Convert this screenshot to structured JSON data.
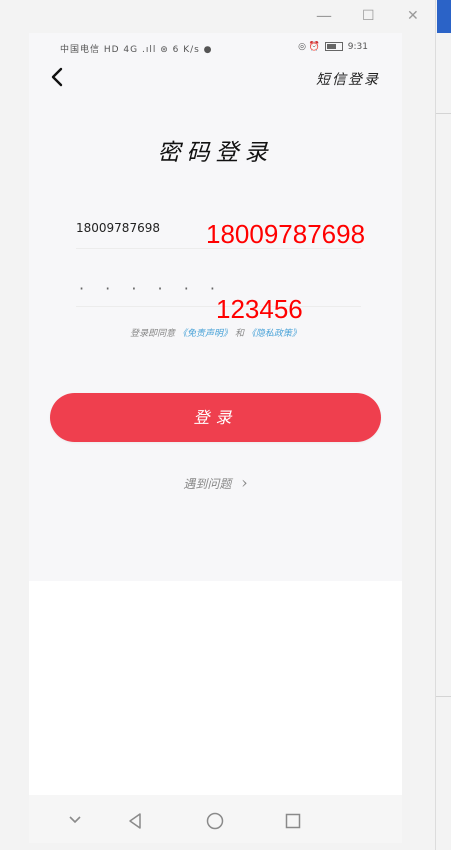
{
  "window": {
    "minimize_glyph": "—",
    "maximize_glyph": "☐",
    "close_glyph": "✕"
  },
  "status_bar": {
    "left_text": "中国电信 HD 4G .ıll ⊛ 6 K/s ●",
    "right_text": "◎ ⏰",
    "time": "9:31"
  },
  "header": {
    "back_icon": "chevron-left-icon",
    "sms_login": "短信登录"
  },
  "page": {
    "title": "密码登录",
    "phone_value": "18009787698",
    "phone_overlay": "18009787698",
    "password_dots": "· · · · · ·",
    "password_overlay": "123456",
    "agree_prefix": "登录即同意",
    "agree_link1": "《免责声明》",
    "agree_mid": "和",
    "agree_link2": "《隐私政策》",
    "login_button": "登录",
    "help_text": "遇到问题",
    "help_chevron": "›"
  },
  "colors": {
    "primary": "#ef3f4e",
    "link": "#4aa3d8",
    "overlay_red": "#ff0000",
    "accent": "#2b63c7"
  }
}
